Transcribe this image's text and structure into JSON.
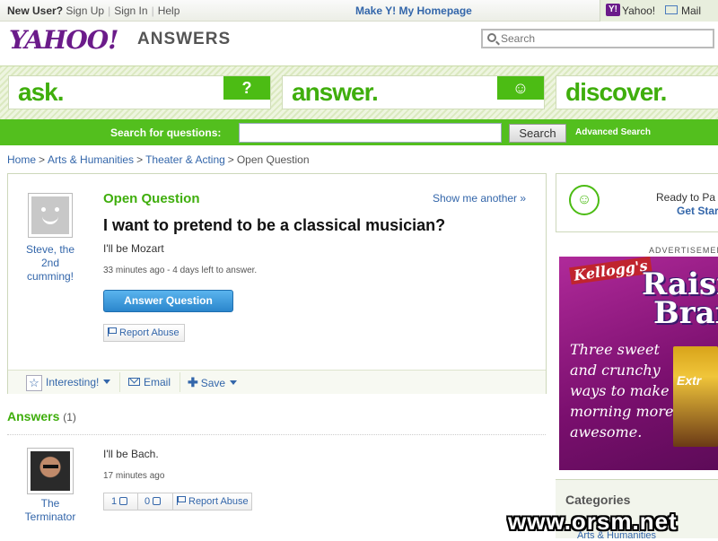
{
  "topbar": {
    "new_user": "New User?",
    "sign_up": "Sign Up",
    "sign_in": "Sign In",
    "help": "Help",
    "make_homepage": "Make Y! My Homepage",
    "yahoo_link": "Yahoo!",
    "mail_link": "Mail"
  },
  "header": {
    "logo": "YAHOO!",
    "product": "ANSWERS",
    "search_placeholder": "Search"
  },
  "tabs": [
    {
      "label": "ask.",
      "badge": "?"
    },
    {
      "label": "answer.",
      "badge": "☺"
    },
    {
      "label": "discover."
    }
  ],
  "search_bar": {
    "label": "Search for questions:",
    "button": "Search",
    "advanced": "Advanced Search"
  },
  "breadcrumb": [
    "Home",
    "Arts & Humanities",
    "Theater & Acting",
    "Open Question"
  ],
  "question": {
    "asker": "Steve, the 2nd cumming!",
    "status": "Open Question",
    "show_another": "Show me another »",
    "title": "I want to pretend to be a classical musician?",
    "detail": "I'll be Mozart",
    "meta": "33 minutes ago - 4 days left to answer.",
    "answer_button": "Answer Question",
    "report": "Report Abuse",
    "actions": {
      "interesting": "Interesting!",
      "email": "Email",
      "save": "Save"
    }
  },
  "answers": {
    "heading": "Answers",
    "count": "(1)",
    "items": [
      {
        "user": "The Terminator",
        "text": "I'll be Bach.",
        "meta": "17 minutes ago",
        "up": "1",
        "down": "0",
        "report": "Report Abuse"
      }
    ]
  },
  "sidebar": {
    "ready_line1": "Ready to Pa",
    "ready_line2": "Get Star",
    "ad_label": "ADVERTISEMEN",
    "ad": {
      "brand": "Kellogg's",
      "product_line1": "Raisi",
      "product_line2": "Bran",
      "copy": "Three sweet and crunchy ways to make morning more awesome.",
      "box_text": "Extr"
    },
    "categories_heading": "Categories",
    "categories_item": "Arts & Humanities"
  },
  "watermark": "www.orsm.net",
  "colors": {
    "green": "#53bf1e",
    "purple": "#6b1b8a",
    "link": "#3366aa"
  }
}
